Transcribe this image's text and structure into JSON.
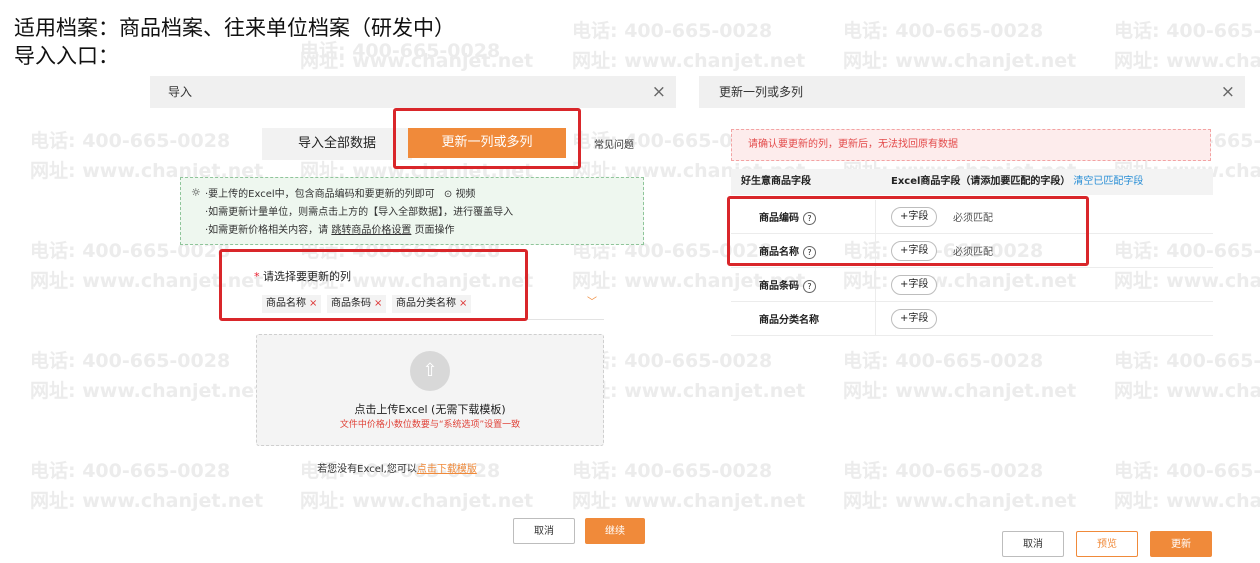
{
  "doc": {
    "line1": "适用档案：商品档案、往来单位档案（研发中）",
    "line2": "导入入口："
  },
  "watermark": {
    "phone": "电话: 400-665-0028",
    "web": "网址: www.chanjet.net"
  },
  "import_dialog": {
    "title": "导入",
    "close": "×",
    "tab_all": "导入全部数据",
    "tab_update": "更新一列或多列",
    "faq": "常见问题",
    "tip_icon": "lightbulb-icon",
    "tip1_pre": "·要上传的Excel中，包含商品编码和要更新的列即可",
    "tip1_video": "视频",
    "tip2": "·如需更新计量单位，则需点击上方的【导入全部数据】，进行覆盖导入",
    "tip3_pre": "·如需更新价格相关内容，请",
    "tip3_link": "跳转商品价格设置",
    "tip3_post": "页面操作",
    "select_star": "*",
    "select_label": "请选择要更新的列",
    "chips": [
      "商品名称",
      "商品条码",
      "商品分类名称"
    ],
    "chip_remove": "×",
    "upload_icon": "upload-arrow-icon",
    "upload_title": "点击上传Excel (无需下载模板)",
    "upload_note": "文件中价格小数位数要与“系统选项”设置一致",
    "no_excel_text": "若您没有Excel,您可以",
    "download_link": "点击下载模版",
    "cancel": "取消",
    "continue": "继续"
  },
  "update_dialog": {
    "title": "更新一列或多列",
    "close": "×",
    "warning": "请确认要更新的列，更新后，无法找回原有数据",
    "col1": "好生意商品字段",
    "col2": "Excel商品字段（请添加要匹配的字段）",
    "clear": "清空已匹配字段",
    "rows": [
      {
        "name": "商品编码",
        "add": "+字段",
        "note": "必须匹配"
      },
      {
        "name": "商品名称",
        "add": "+字段",
        "note": "必须匹配"
      },
      {
        "name": "商品条码",
        "add": "+字段",
        "note": ""
      },
      {
        "name": "商品分类名称",
        "add": "+字段",
        "note": ""
      }
    ],
    "help_glyph": "?",
    "cancel": "取消",
    "preview": "预览",
    "update": "更新"
  },
  "colors": {
    "accent": "#f08a3a",
    "highlight": "#d9262a",
    "link": "#2a8fd6"
  }
}
